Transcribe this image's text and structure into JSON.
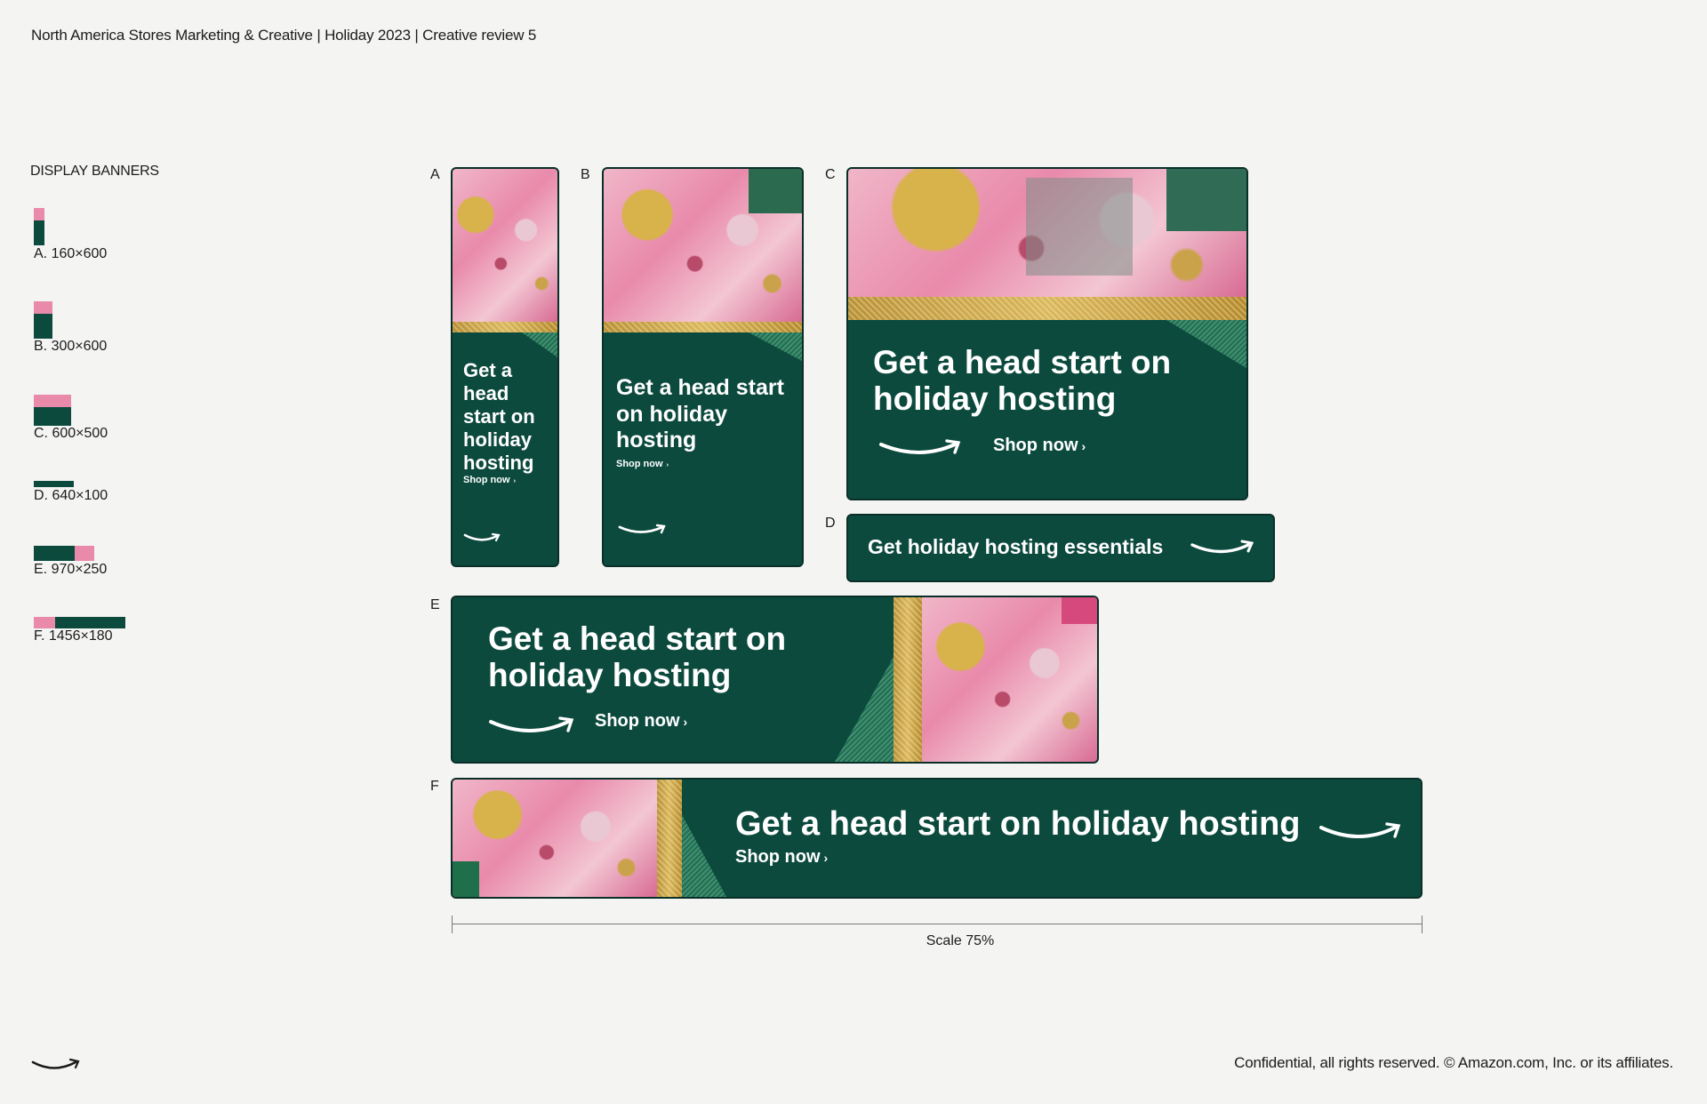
{
  "header": "North America Stores Marketing & Creative  | Holiday 2023  |  Creative review 5",
  "section_title": "DISPLAY BANNERS",
  "sizes": [
    {
      "label": "A. 160×600"
    },
    {
      "label": "B. 300×600"
    },
    {
      "label": "C. 600×500"
    },
    {
      "label": "D. 640×100"
    },
    {
      "label": "E. 970×250"
    },
    {
      "label": "F. 1456×180"
    }
  ],
  "banners": {
    "a": {
      "letter": "A",
      "headline": "Get a head start on holiday hosting",
      "cta": "Shop now"
    },
    "b": {
      "letter": "B",
      "headline": "Get a head start on holiday hosting",
      "cta": "Shop now"
    },
    "c": {
      "letter": "C",
      "headline": "Get a head start on holiday hosting",
      "cta": "Shop now"
    },
    "d": {
      "letter": "D",
      "headline": "Get holiday hosting essentials"
    },
    "e": {
      "letter": "E",
      "headline": "Get a head start on holiday hosting",
      "cta": "Shop now"
    },
    "f": {
      "letter": "F",
      "headline": "Get a head start on holiday hosting",
      "cta": "Shop now"
    }
  },
  "cta_chevron": "›",
  "scale_label": "Scale 75%",
  "footer": "Confidential, all rights reserved. © Amazon.com, Inc. or its affiliates.",
  "colors": {
    "banner_green": "#0c4a3e",
    "gold": "#d9b75e",
    "pink": "#e98aab",
    "background": "#f4f4f3"
  },
  "icons": {
    "logo": "amazon-smile-icon"
  }
}
